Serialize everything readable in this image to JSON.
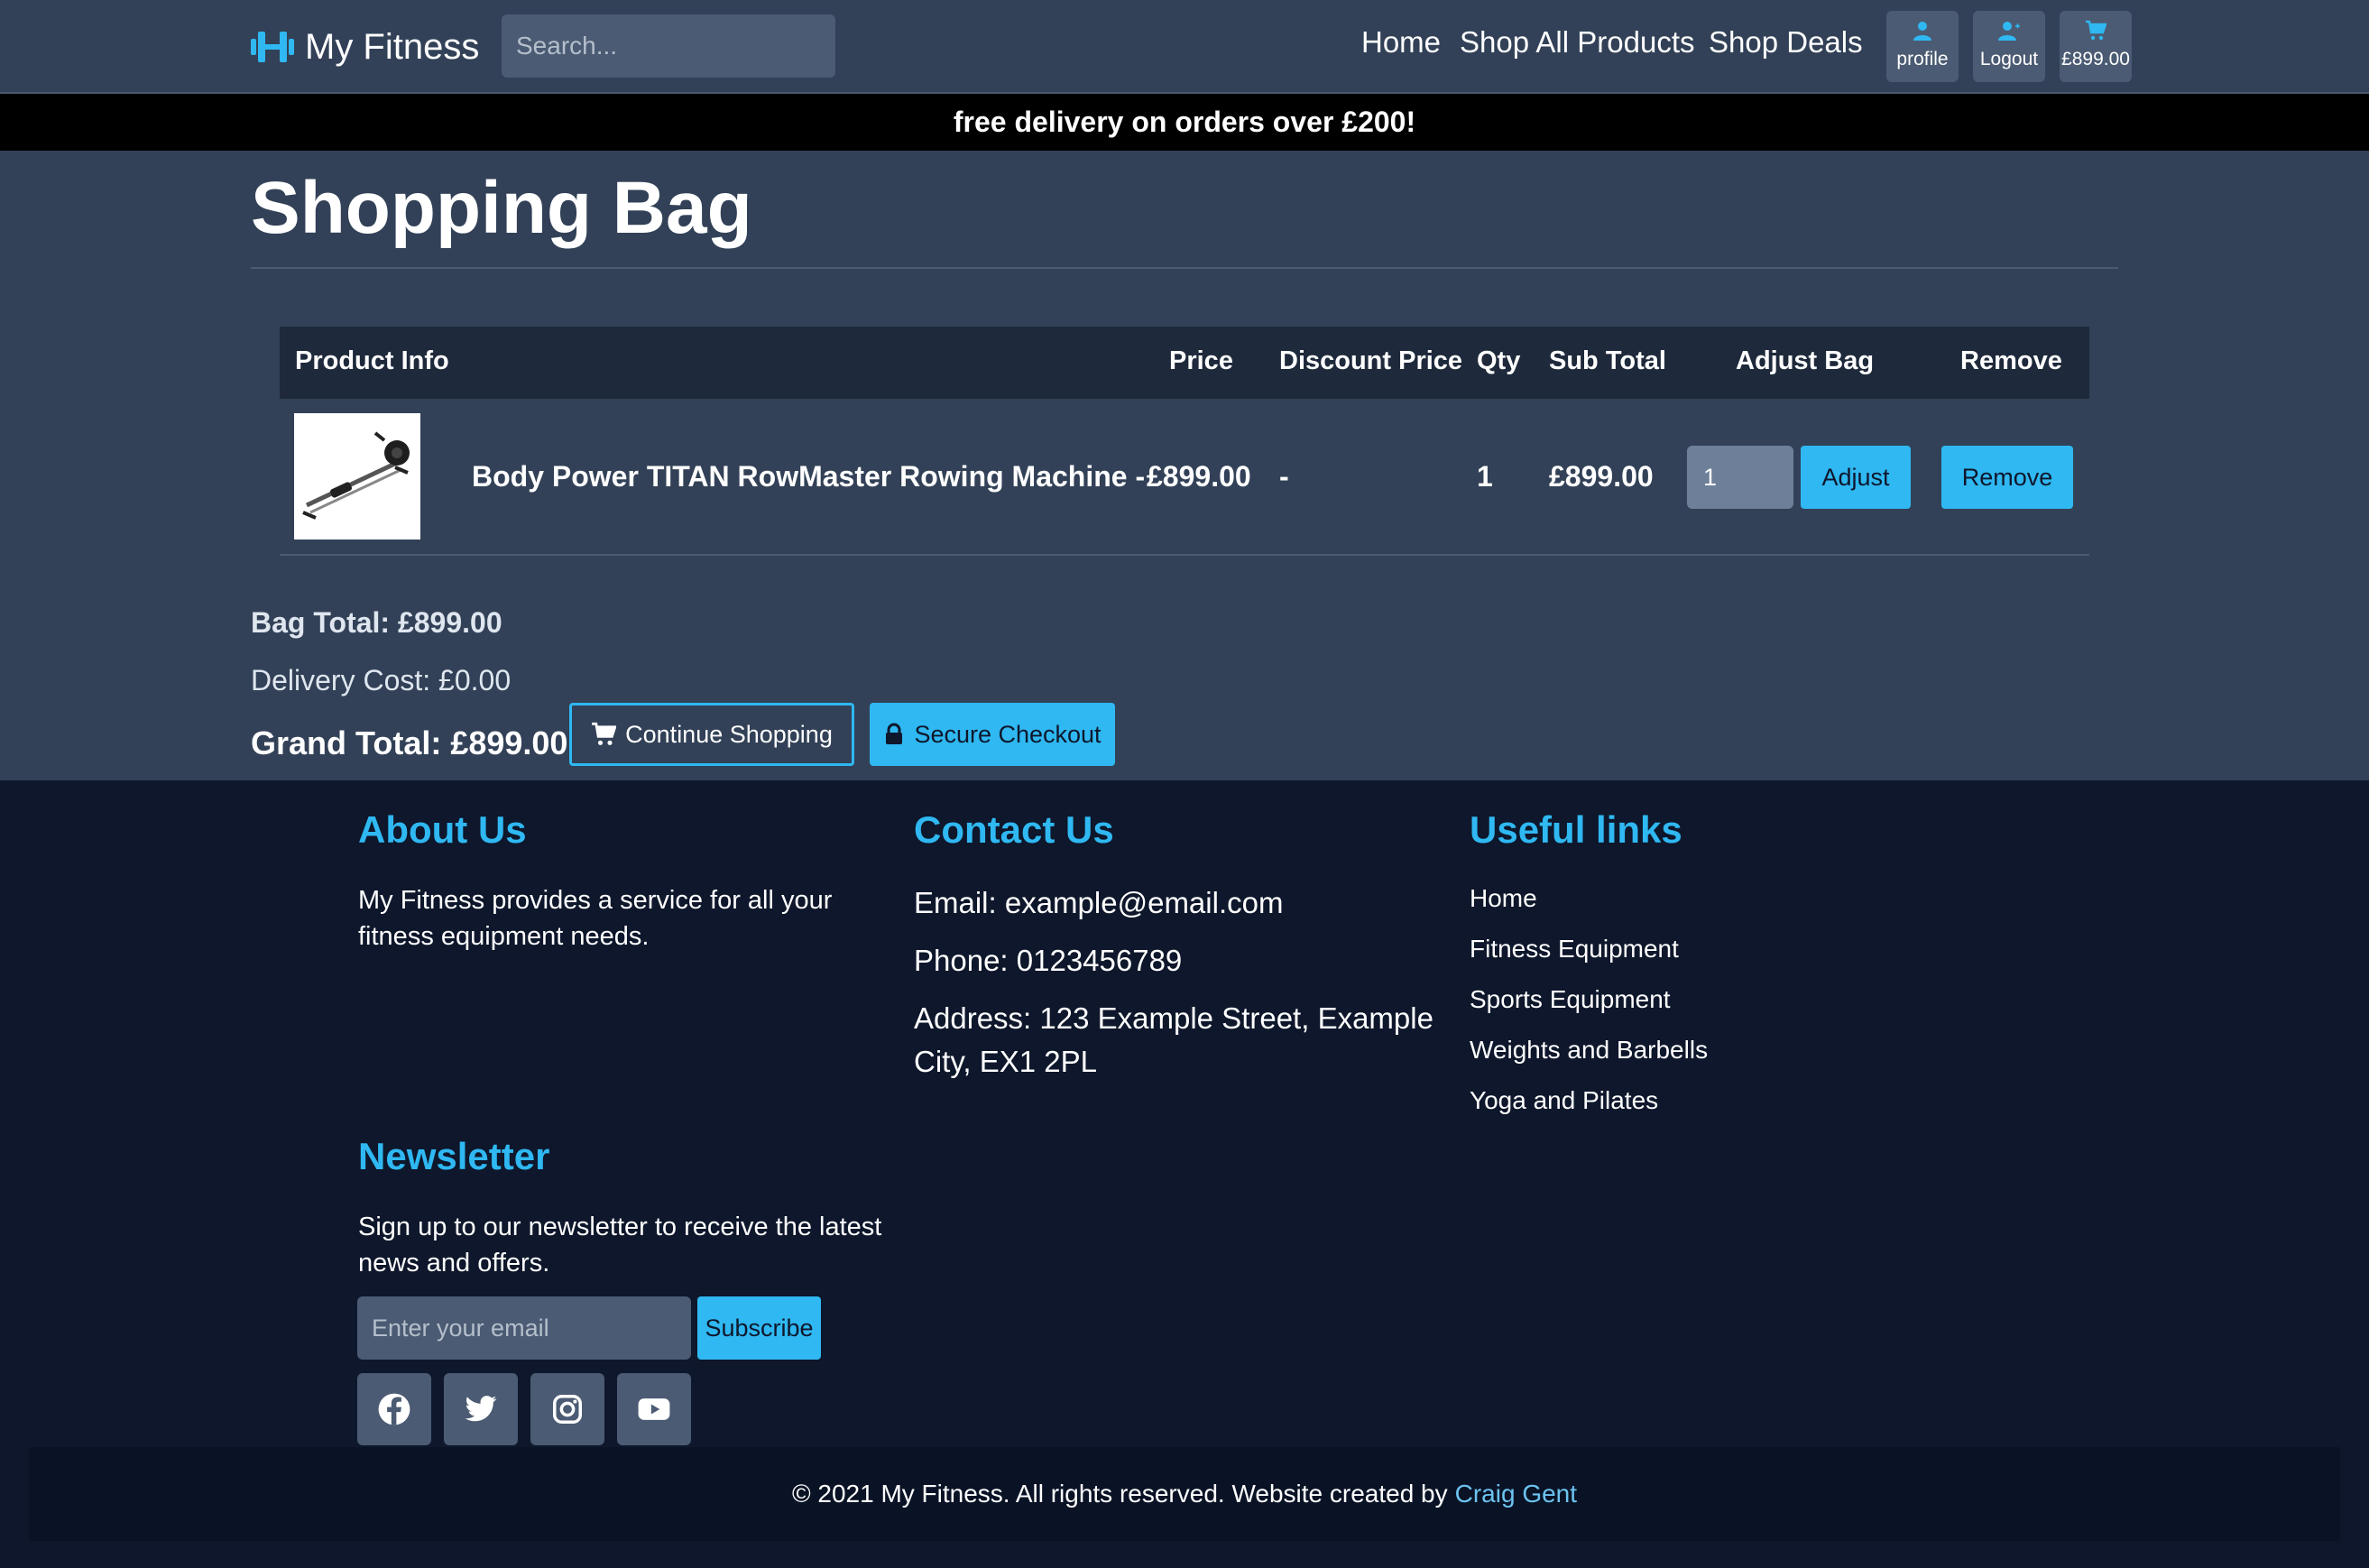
{
  "header": {
    "brand_name": "My Fitness",
    "search_placeholder": "Search...",
    "nav": [
      "Home",
      "Shop All Products",
      "Shop Deals"
    ],
    "profile_label": "profile",
    "logout_label": "Logout",
    "cart_total": "£899.00"
  },
  "banner": {
    "text": "free delivery on orders over £200!"
  },
  "main": {
    "title": "Shopping Bag",
    "table": {
      "headers": [
        "Product Info",
        "Price",
        "Discount Price",
        "Qty",
        "Sub Total",
        "Adjust Bag",
        "Remove"
      ],
      "rows": [
        {
          "name": "Body Power TITAN RowMaster Rowing Machine -",
          "price": "£899.00",
          "discount": "-",
          "qty": "1",
          "subtotal": "£899.00",
          "qty_value": "1",
          "adjust_label": "Adjust",
          "remove_label": "Remove"
        }
      ]
    },
    "bag_total": "Bag Total: £899.00",
    "delivery_cost": "Delivery Cost: £0.00",
    "grand_total": "Grand Total: £899.00",
    "continue_label": "Continue Shopping",
    "checkout_label": "Secure Checkout"
  },
  "footer": {
    "about_title": "About Us",
    "about_text_1": "My Fitness provides a service for all your",
    "about_text_2": "fitness equipment needs.",
    "contact_title": "Contact Us",
    "email": "Email: example@email.com",
    "phone": "Phone: 0123456789",
    "address_1": "Address: 123 Example Street, Example",
    "address_2": "City, EX1 2PL",
    "links_title": "Useful links",
    "links": [
      "Home",
      "Fitness Equipment",
      "Sports Equipment",
      "Weights and Barbells",
      "Yoga and Pilates"
    ],
    "newsletter_title": "Newsletter",
    "newsletter_text_1": "Sign up to our newsletter to receive the latest",
    "newsletter_text_2": "news and offers.",
    "email_placeholder": "Enter your email",
    "subscribe_label": "Subscribe",
    "social_icons": [
      "facebook-icon",
      "twitter-icon",
      "instagram-icon",
      "youtube-icon"
    ],
    "copyright": "© 2021 My Fitness. All rights reserved.  Website created by",
    "author": "Craig Gent"
  },
  "colors": {
    "accent": "#2fb8f2",
    "header_bg": "#324157",
    "footer_bg": "#0e172b",
    "banner_bg": "#000000"
  }
}
